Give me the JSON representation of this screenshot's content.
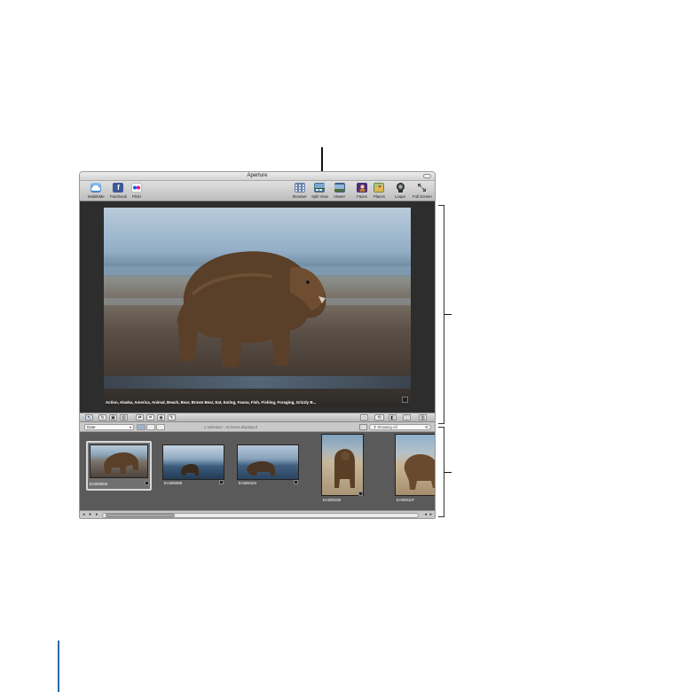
{
  "window": {
    "title": "Aperture"
  },
  "toolbar": {
    "left": [
      {
        "label": "MobileMe",
        "icon": "mobileme-icon",
        "color": "#4a90d9"
      },
      {
        "label": "Facebook",
        "icon": "facebook-icon",
        "color": "#3b5998"
      },
      {
        "label": "Flickr",
        "icon": "flickr-icon",
        "color": "#ffffff"
      }
    ],
    "right": [
      {
        "label": "Browser",
        "icon": "browser-icon"
      },
      {
        "label": "Split View",
        "icon": "split-view-icon"
      },
      {
        "label": "Viewer",
        "icon": "viewer-icon"
      },
      {
        "label": "Faces",
        "icon": "faces-icon"
      },
      {
        "label": "Places",
        "icon": "places-icon"
      },
      {
        "label": "Loupe",
        "icon": "loupe-icon"
      },
      {
        "label": "Full Screen",
        "icon": "full-screen-icon"
      }
    ],
    "facebook_glyph": "f",
    "flickr_glyph": "●●"
  },
  "viewer": {
    "caption": "Action, Alaska, America, Animal, Beach, Bear, Brown Bear, Eat, Eating, Fauna, Fish, Fishing, Foraging, Grizzly B..."
  },
  "browser_bar": {
    "sort_value": "Date",
    "status": "1 selected – 21 items displayed",
    "search_text": "Showing All",
    "search_clear": "⊗"
  },
  "thumbnails": [
    {
      "name": "EA000006"
    },
    {
      "name": "EA000099"
    },
    {
      "name": "EA000104"
    },
    {
      "name": "EA000106"
    },
    {
      "name": "EA000107"
    }
  ],
  "colors": {
    "accent": "#9fb2c9",
    "viewer_bg": "#2d2d2d",
    "browser_bg": "#5a5a5a"
  }
}
